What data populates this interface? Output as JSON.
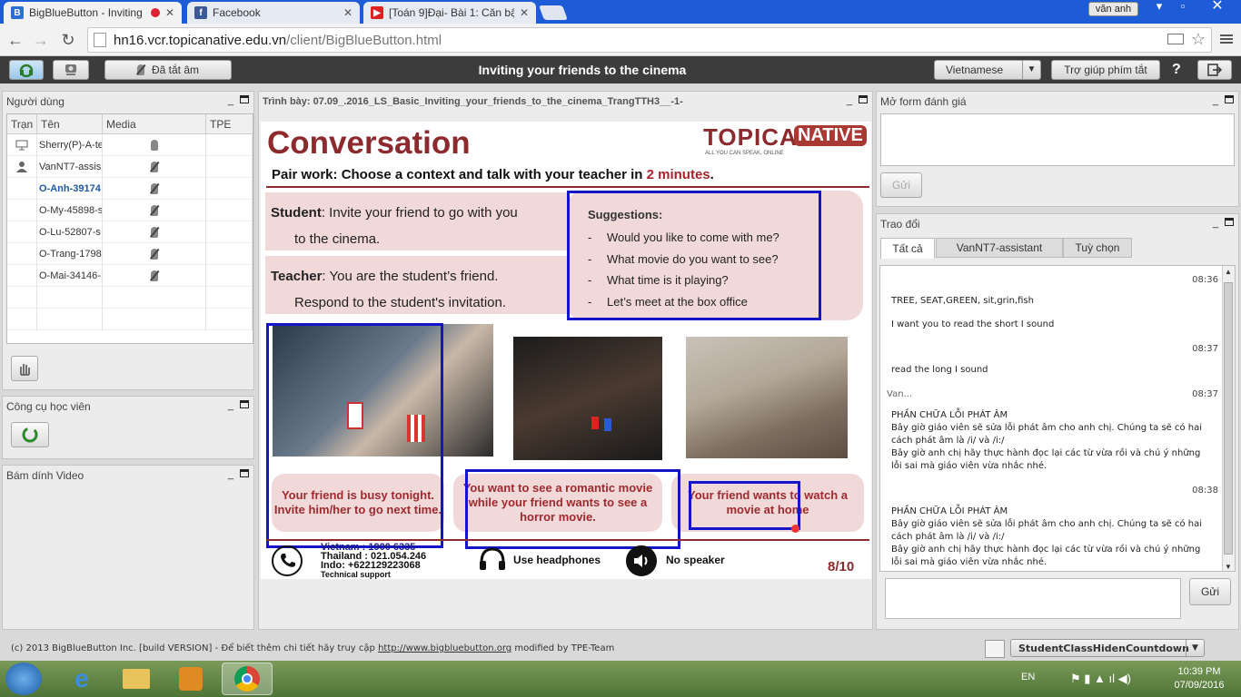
{
  "browser": {
    "tabs": [
      {
        "title": "BigBlueButton - Inviting",
        "active": true
      },
      {
        "title": "Facebook",
        "active": false
      },
      {
        "title": "[Toán 9]Đại- Bài 1: Căn bậ",
        "active": false
      }
    ],
    "profile_name": "văn anh",
    "url_host": "hn16.vcr.topicanative.edu.vn",
    "url_path": "/client/BigBlueButton.html"
  },
  "toolbar": {
    "mute_label": "Đã tắt âm",
    "meeting_title": "Inviting your friends to the cinema",
    "language": "Vietnamese",
    "shortcut_help": "Trợ giúp phím tắt",
    "help": "?"
  },
  "users_panel": {
    "title": "Người dùng",
    "columns": [
      "Trạn",
      "Tên",
      "Media",
      "TPE"
    ],
    "rows": [
      {
        "name": "Sherry(P)-A-te",
        "role": "presenter"
      },
      {
        "name": "VanNT7-assis",
        "role": "moderator"
      },
      {
        "name": "O-Anh-39174",
        "role": "viewer"
      },
      {
        "name": "O-My-45898-s",
        "role": "viewer"
      },
      {
        "name": "O-Lu-52807-s",
        "role": "viewer"
      },
      {
        "name": "O-Trang-1798",
        "role": "viewer"
      },
      {
        "name": "O-Mai-34146-",
        "role": "viewer"
      }
    ]
  },
  "student_tools": {
    "title": "Công cụ học viên"
  },
  "video_dock": {
    "title": "Bám dính Video"
  },
  "presentation": {
    "title": "Trình bày: 07.09_.2016_LS_Basic_Inviting_your_friends_to_the_cinema_TrangTTH3__-1-",
    "slide": {
      "heading": "Conversation",
      "logo_main": "TOPICA",
      "logo_badge": "NATIVE",
      "logo_tagline": "ALL YOU CAN SPEAK, ONLINE",
      "instruction_prefix": "Pair work: Choose a context and talk with your teacher in ",
      "instruction_highlight": "2 minutes",
      "instruction_suffix": ".",
      "student_label": "Student",
      "student_text_1": ": Invite your friend to go with you",
      "student_text_2": "to the cinema.",
      "teacher_label": "Teacher",
      "teacher_text_1": ": You are the student’s friend.",
      "teacher_text_2": "Respond to the student's invitation.",
      "suggestions_title": "Suggestions:",
      "suggestions": [
        "Would you like to come with me?",
        "What movie do you want to see?",
        "What time is it playing?",
        "Let’s meet at the box office"
      ],
      "contexts": [
        "Your friend is busy tonight. Invite him/her to go next time.",
        "You want to see a romantic movie while your friend wants to see a horror movie.",
        "Your friend wants to watch a movie at home"
      ],
      "support_lines": [
        "Vietnam : 1900 6335",
        "Thailand : 021.054.246",
        "Indo: +622129223068",
        "Technical support"
      ],
      "headphones_label": "Use headphones",
      "no_speaker_label": "No speaker",
      "page": "8/10"
    }
  },
  "feedback_panel": {
    "title": "Mở form đánh giá",
    "send": "Gửi"
  },
  "chat_panel": {
    "title": "Trao đổi",
    "tabs": [
      "Tất cả",
      "VanNT7-assistant",
      "Tuỳ chọn"
    ],
    "messages": [
      {
        "time": "08:36",
        "sender": "",
        "lines": [
          "TREE, SEAT,GREEN, sit,grin,fish",
          "I want you to read the short I sound"
        ]
      },
      {
        "time": "08:37",
        "sender": "",
        "lines": [
          "read the long I sound"
        ]
      },
      {
        "time": "08:37",
        "sender": "Van...",
        "lines": [
          "PHẦN CHỮA LỖI PHÁT ÂM",
          "Bây giờ giáo viên sẽ sửa lỗi phát âm cho anh chị. Chúng ta sẽ có hai",
          "cách phát âm là  /i/ và /i:/",
          "Bây giờ anh chị hãy thực hành đọc lại các từ vừa rồi và chú ý những",
          "lỗi sai mà giáo viên vừa nhắc nhé."
        ]
      },
      {
        "time": "08:38",
        "sender": "",
        "lines": [
          "PHẦN CHỮA LỖI PHÁT ÂM",
          "Bây giờ giáo viên sẽ sửa lỗi phát âm cho anh chị. Chúng ta sẽ có hai",
          "cách phát âm là  /i/ và /i:/",
          "Bây giờ anh chị hãy thực hành đọc lại các từ vừa rồi và chú ý những",
          "lỗi sai mà giáo viên vừa nhắc nhé."
        ]
      }
    ],
    "send": "Gửi"
  },
  "footer": {
    "text": "(c) 2013 BigBlueButton Inc. [build VERSION] - Để biết thêm chi tiết hãy truy cập ",
    "link": "http://www.bigbluebutton.org",
    "suffix": " modified by TPE-Team",
    "layout_select": "StudentClassHidenCountdown"
  },
  "taskbar": {
    "lang": "EN",
    "time": "10:39 PM",
    "date": "07/09/2016"
  }
}
